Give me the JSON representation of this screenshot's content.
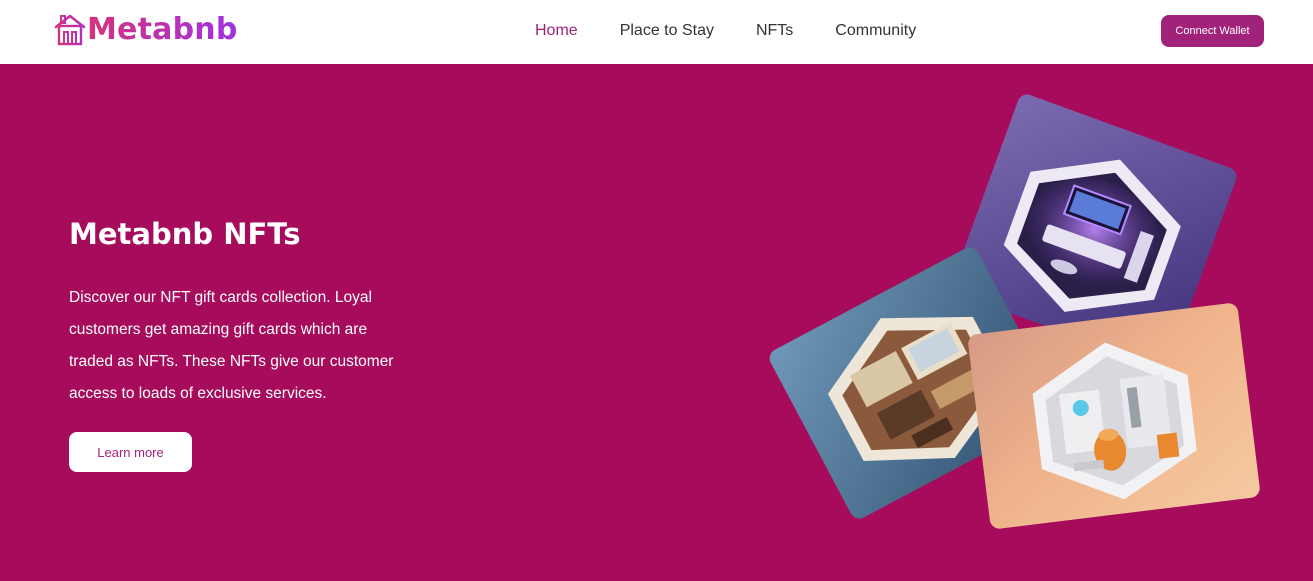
{
  "brand": {
    "name": "Metabnb",
    "logo_icon": "house-icon",
    "gradient_start": "#D6337E",
    "gradient_end": "#9D33E0"
  },
  "nav": {
    "links": [
      {
        "label": "Home",
        "active": true
      },
      {
        "label": "Place to Stay",
        "active": false
      },
      {
        "label": "NFTs",
        "active": false
      },
      {
        "label": "Community",
        "active": false
      }
    ],
    "connect_label": "Connect Wallet"
  },
  "hero": {
    "title": "Metabnb NFTs",
    "description": "Discover our NFT gift cards collection. Loyal customers get amazing gift cards which are traded as NFTs. These NFTs give our customer access to loads of exclusive services.",
    "cta_label": "Learn more"
  },
  "colors": {
    "hero_bg": "#A60B5C",
    "accent": "#A02279",
    "nav_text": "#333333"
  },
  "cards": [
    {
      "name": "purple-room-nft-card",
      "theme": "purple"
    },
    {
      "name": "blue-room-nft-card",
      "theme": "blue"
    },
    {
      "name": "orange-room-nft-card",
      "theme": "orange"
    }
  ]
}
